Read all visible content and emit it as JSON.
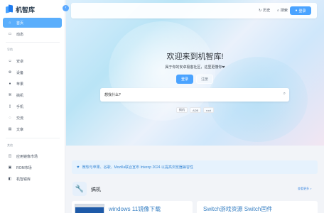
{
  "brand": {
    "name": "机智库",
    "collapse_icon": "chevron-left-icon"
  },
  "sidebar": {
    "top_items": [
      {
        "label": "首页",
        "icon": "home-icon",
        "active": true
      },
      {
        "label": "动态",
        "icon": "message-icon",
        "active": false
      }
    ],
    "section1_title": "导航",
    "section1_items": [
      {
        "label": "安卓",
        "icon": "android-icon"
      },
      {
        "label": "设备",
        "icon": "settings-icon"
      },
      {
        "label": "苹果",
        "icon": "apple-icon"
      },
      {
        "label": "搞机",
        "icon": "wrench-icon"
      },
      {
        "label": "手机",
        "icon": "phone-icon"
      },
      {
        "label": "交流",
        "icon": "chat-icon"
      },
      {
        "label": "文章",
        "icon": "article-icon"
      }
    ],
    "section2_title": "其他",
    "section2_items": [
      {
        "label": "应用镜像市场",
        "icon": "store-icon"
      },
      {
        "label": "ROM市场",
        "icon": "box-icon"
      },
      {
        "label": "机智镜库",
        "icon": "book-icon"
      }
    ]
  },
  "topbar": {
    "history_label": "历史",
    "search_label": "搜索",
    "login_label": "登录"
  },
  "hero": {
    "title": "欢迎来到机智库!",
    "subtitle": "属于你的安卓极客社区，这里更懂你❤",
    "primary_button": "登录",
    "secondary_button": "注册",
    "search_placeholder": "想找什么?",
    "tags": [
      "搞机",
      "ADB",
      "root"
    ]
  },
  "notice": {
    "text": "微软与苹果、谷歌、Mozilla联合宣布 Interop 2024 以提高浏览器兼容性"
  },
  "section": {
    "title": "搞机",
    "more_label": "查看更多 >"
  },
  "cards": [
    {
      "title": "windows 11镜像下载"
    },
    {
      "title": "Switch游戏资源 Switch固件"
    }
  ],
  "colors": {
    "accent": "#4aa3ff",
    "active_nav": "#5aaefc",
    "notice_bg": "#e6f2fd",
    "notice_text": "#3a89d6"
  }
}
